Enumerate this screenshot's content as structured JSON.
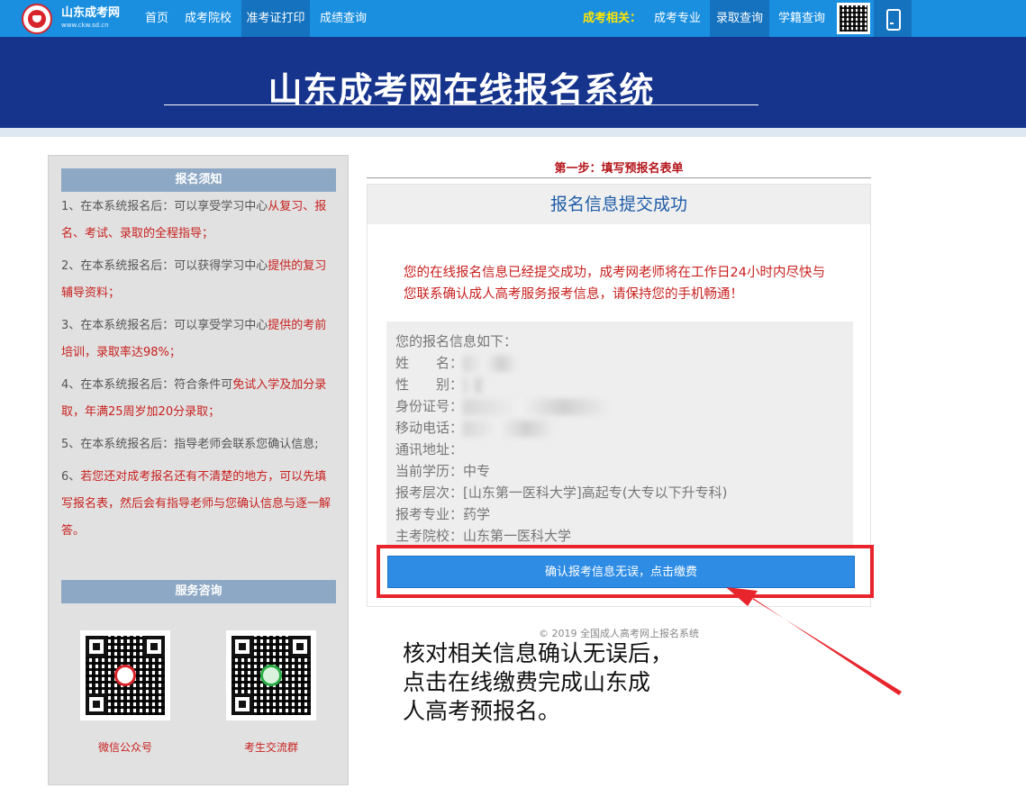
{
  "nav": {
    "brand": "山东成考网",
    "brand_url": "www.ckw.sd.cn",
    "items": [
      "首页",
      "成考院校",
      "准考证打印",
      "成绩查询"
    ],
    "right_label": "成考相关：",
    "right_items": [
      "成考专业",
      "录取查询",
      "学籍查询"
    ],
    "icons": {
      "logo": "logo-icon",
      "qr": "qr-code-icon",
      "phone": "mobile-phone-icon"
    }
  },
  "banner": {
    "title": "山东成考网在线报名系统"
  },
  "sidebar": {
    "notice_head": "报名须知",
    "notes": [
      {
        "plain": "1、在本系统报名后：可以享受学习中心",
        "red": "从复习、报名、考试、录取的全程指导；"
      },
      {
        "plain": "2、在本系统报名后：可以获得学习中心",
        "red": "提供的复习辅导资料；"
      },
      {
        "plain": "3、在本系统报名后：可以享受学习中心",
        "red": "提供的考前培训，录取率达98%；"
      },
      {
        "plain": "4、在本系统报名后：符合条件可",
        "red": "免试入学及加分录取，年满25周岁加20分录取；"
      },
      {
        "plain": "5、在本系统报名后：指导老师会联系您确认信息;",
        "red": ""
      },
      {
        "plain": "6、",
        "red": "若您还对成考报名还有不清楚的地方，可以先填写报名表，然后会有指导老师与您确认信息与逐一解答。"
      }
    ],
    "service_head": "服务咨询",
    "qr": [
      {
        "label": "微信公众号"
      },
      {
        "label": "考生交流群"
      }
    ]
  },
  "main": {
    "step": "第一步：填写预报名表单",
    "panel_title": "报名信息提交成功",
    "notice": "您的在线报名信息已经提交成功，成考网老师将在工作日24小时内尽快与您联系确认成人高考服务报考信息，请保持您的手机畅通！",
    "info_title": "您的报名信息如下：",
    "fields": [
      {
        "label": "姓　　名：",
        "value": ""
      },
      {
        "label": "性　　别：",
        "value": ""
      },
      {
        "label": "身份证号：",
        "value": ""
      },
      {
        "label": "移动电话：",
        "value": ""
      },
      {
        "label": "通讯地址：",
        "value": ""
      },
      {
        "label": "当前学历：",
        "value": "中专"
      },
      {
        "label": "报考层次：",
        "value": "[山东第一医科大学]高起专(大专以下升专科)"
      },
      {
        "label": "报考专业：",
        "value": "药学"
      },
      {
        "label": "主考院校：",
        "value": "山东第一医科大学"
      }
    ],
    "confirm_button": "确认报考信息无误，点击缴费",
    "copyright": "© 2019 全国成人高考网上报名系统"
  },
  "annotation": {
    "caption_lines": [
      "核对相关信息确认无误后，",
      "点击在线缴费完成山东成",
      "人高考预报名。"
    ],
    "color": "#e8242c"
  }
}
